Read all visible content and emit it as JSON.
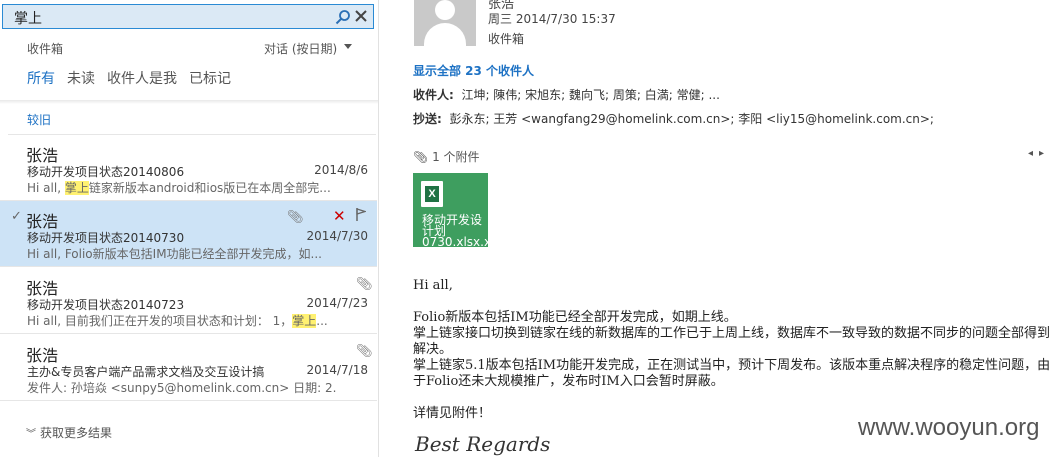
{
  "search": {
    "value": "掌上"
  },
  "list": {
    "folder": "收件箱",
    "sort": "对话 (按日期)",
    "filters": [
      "所有",
      "未读",
      "收件人是我",
      "已标记"
    ],
    "group": "较旧",
    "more": "获取更多结果"
  },
  "mails": [
    {
      "sender": "张浩",
      "subject": "移动开发项目状态20140806",
      "date": "2014/8/6",
      "preview_pre": "Hi all, ",
      "preview_hl": "掌上",
      "preview_post": "链家新版本android和ios版已在本周全部完..."
    },
    {
      "sender": "张浩",
      "subject": "移动开发项目状态20140730",
      "date": "2014/7/30",
      "preview_pre": "Hi all, Folio新版本包括IM功能已经全部开发完成，如...",
      "preview_hl": "",
      "preview_post": ""
    },
    {
      "sender": "张浩",
      "subject": "移动开发项目状态20140723",
      "date": "2014/7/23",
      "preview_pre": "Hi all, 目前我们正在开发的项目状态和计划： 1，",
      "preview_hl": "掌上",
      "preview_post": "..."
    },
    {
      "sender": "张浩",
      "subject": "主办&专员客户端产品需求文档及交互设计搞",
      "date": "2014/7/18",
      "preview_pre": "发件人: 孙培焱 <sunpy5@homelink.com.cn> 日期: 2...",
      "preview_hl": "",
      "preview_post": ""
    }
  ],
  "reading": {
    "sender": "张浩",
    "date": "周三 2014/7/30 15:37",
    "folder": "收件箱",
    "show_all": "显示全部 23 个收件人",
    "to_label": "收件人:",
    "to": "江坤;  陳伟;  宋旭东;  魏向飞;  周策;  白満;  常健;  ...",
    "cc_label": "抄送:",
    "cc": "彭永东;  王芳 <wangfang29@homelink.com.cn>;  李阳 <liy15@homelink.com.cn>;",
    "attach_count": "1 个附件",
    "attach_name": "移动开发设计划0730.xlsx.x",
    "body": [
      "Hi all,",
      "",
      "Folio新版本包括IM功能已经全部开发完成，如期上线。",
      "掌上链家接口切换到链家在线的新数据库的工作已于上周上线，数据库不一致导致的数据不同步的问题全部得到解决。",
      "掌上链家5.1版本包括IM功能开发完成，正在测试当中，预计下周发布。该版本重点解决程序的稳定性问题，由于Folio还未大规模推广，发布时IM入口会暂时屏蔽。",
      "",
      "详情见附件！"
    ],
    "signature": "Best Regards"
  },
  "watermark": "www.wooyun.org",
  "colors": {
    "accent": "#1e72c4",
    "selected": "#cde3f6",
    "highlight": "#fff171",
    "excel": "#3e9e5f"
  }
}
